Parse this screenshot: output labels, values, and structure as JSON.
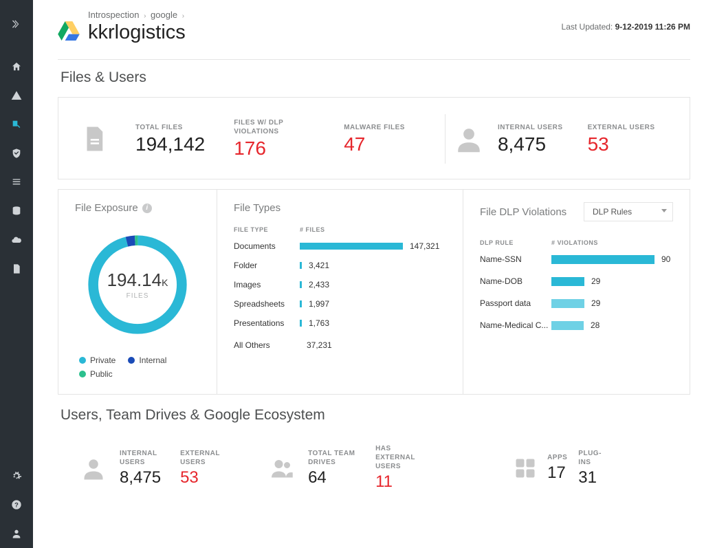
{
  "breadcrumb": {
    "a": "Introspection",
    "b": "google"
  },
  "page_title": "kkrlogistics",
  "last_updated": {
    "label": "Last Updated:",
    "value": "9-12-2019 11:26 PM"
  },
  "sections": {
    "files_users_title": "Files & Users",
    "users_drives_title": "Users, Team Drives & Google Ecosystem"
  },
  "top_stats": {
    "total_files": {
      "label": "TOTAL FILES",
      "value": "194,142"
    },
    "dlp_violations": {
      "label": "FILES W/ DLP VIOLATIONS",
      "value": "176"
    },
    "malware": {
      "label": "MALWARE FILES",
      "value": "47"
    },
    "internal_users": {
      "label": "INTERNAL USERS",
      "value": "8,475"
    },
    "external_users": {
      "label": "EXTERNAL USERS",
      "value": "53"
    }
  },
  "file_exposure": {
    "title": "File Exposure",
    "center_value": "194.14",
    "center_suffix": "K",
    "center_sub": "FILES",
    "legend": [
      {
        "label": "Private",
        "color": "#2ab8d6"
      },
      {
        "label": "Internal",
        "color": "#1a4bb7"
      },
      {
        "label": "Public",
        "color": "#2cc08e"
      }
    ]
  },
  "file_types": {
    "title": "File Types",
    "head_c1": "FILE TYPE",
    "head_c2": "# FILES",
    "rows": [
      {
        "label": "Documents",
        "display": "147,321",
        "value": 147321
      },
      {
        "label": "Folder",
        "display": "3,421",
        "value": 3421
      },
      {
        "label": "Images",
        "display": "2,433",
        "value": 2433
      },
      {
        "label": "Spreadsheets",
        "display": "1,997",
        "value": 1997
      },
      {
        "label": "Presentations",
        "display": "1,763",
        "value": 1763
      },
      {
        "label": "All Others",
        "display": "37,231",
        "value": 37231
      }
    ]
  },
  "dlp": {
    "title": "File DLP Violations",
    "select_label": "DLP Rules",
    "head_c1": "DLP RULE",
    "head_c2": "# VIOLATIONS",
    "rows": [
      {
        "label": "Name-SSN",
        "value": 90
      },
      {
        "label": "Name-DOB",
        "value": 29
      },
      {
        "label": "Passport data",
        "value": 29
      },
      {
        "label": "Name-Medical C...",
        "value": 28
      }
    ]
  },
  "bottom_stats": {
    "internal_users": {
      "label": "INTERNAL USERS",
      "value": "8,475"
    },
    "external_users": {
      "label": "EXTERNAL USERS",
      "value": "53"
    },
    "total_drives": {
      "label": "TOTAL TEAM DRIVES",
      "value": "64"
    },
    "has_ext": {
      "label": "HAS EXTERNAL USERS",
      "value": "11"
    },
    "apps": {
      "label": "APPS",
      "value": "17"
    },
    "plugins": {
      "label": "PLUG-INS",
      "value": "31"
    }
  },
  "chart_data": [
    {
      "type": "pie",
      "title": "File Exposure",
      "categories": [
        "Private",
        "Internal",
        "Public"
      ],
      "values": [
        96,
        3,
        1
      ],
      "total_label": "194.14K FILES"
    },
    {
      "type": "bar",
      "title": "File Types",
      "categories": [
        "Documents",
        "Folder",
        "Images",
        "Spreadsheets",
        "Presentations",
        "All Others"
      ],
      "values": [
        147321,
        3421,
        2433,
        1997,
        1763,
        37231
      ],
      "xlabel": "# FILES"
    },
    {
      "type": "bar",
      "title": "File DLP Violations",
      "categories": [
        "Name-SSN",
        "Name-DOB",
        "Passport data",
        "Name-Medical C..."
      ],
      "values": [
        90,
        29,
        29,
        28
      ],
      "xlabel": "# VIOLATIONS"
    }
  ]
}
